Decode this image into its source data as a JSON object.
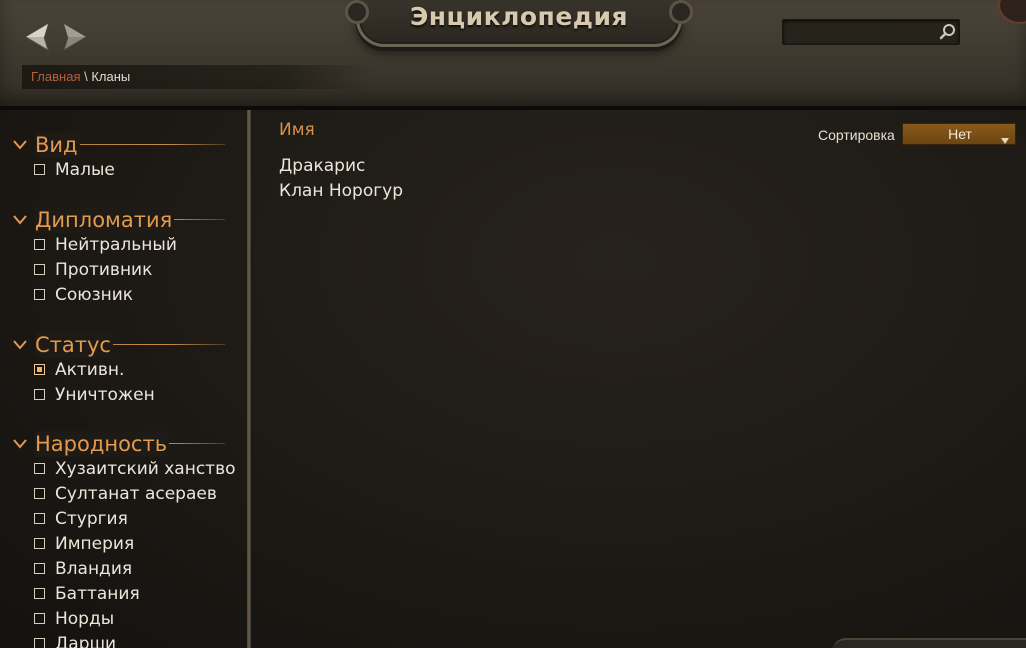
{
  "header": {
    "title": "Энциклопедия",
    "search": {
      "value": "",
      "placeholder": ""
    },
    "breadcrumb": {
      "home": "Главная",
      "separator": "\\",
      "current": "Кланы"
    }
  },
  "sidebar": {
    "groups": [
      {
        "title": "Вид",
        "items": [
          {
            "label": "Малые",
            "checked": false
          }
        ]
      },
      {
        "title": "Дипломатия",
        "items": [
          {
            "label": "Нейтральный",
            "checked": false
          },
          {
            "label": "Противник",
            "checked": false
          },
          {
            "label": "Союзник",
            "checked": false
          }
        ]
      },
      {
        "title": "Статус",
        "items": [
          {
            "label": "Активн.",
            "checked": true
          },
          {
            "label": "Уничтожен",
            "checked": false
          }
        ]
      },
      {
        "title": "Народность",
        "items": [
          {
            "label": "Хузаитский ханство",
            "checked": false
          },
          {
            "label": "Султанат асераев",
            "checked": false
          },
          {
            "label": "Стургия",
            "checked": false
          },
          {
            "label": "Империя",
            "checked": false
          },
          {
            "label": "Вландия",
            "checked": false
          },
          {
            "label": "Баттания",
            "checked": false
          },
          {
            "label": "Норды",
            "checked": false
          },
          {
            "label": "Дарши",
            "checked": false
          }
        ]
      }
    ]
  },
  "main": {
    "column_header": "Имя",
    "sort": {
      "label": "Сортировка",
      "value": "Нет"
    },
    "results": [
      "Дракарис",
      "Клан Норогур"
    ]
  },
  "colors": {
    "accent": "#e39a4e",
    "breadcrumb_home": "#b85f40",
    "sort_select": "#7a4f16",
    "text": "#ece6da"
  },
  "icons": {
    "nav_back": "back-arrow-icon",
    "nav_forward": "forward-arrow-icon",
    "search": "search-icon",
    "group_toggle": "chevron-down-icon",
    "sort_dropdown": "dropdown-arrow-icon"
  }
}
